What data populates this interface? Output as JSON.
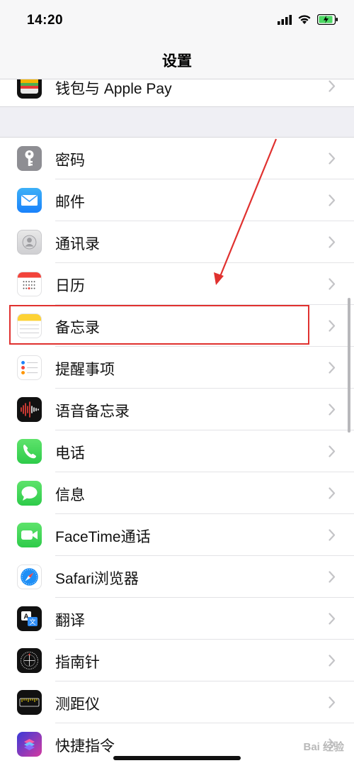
{
  "status_bar": {
    "time": "14:20",
    "icons": [
      "signal-icon",
      "wifi-icon",
      "battery-charging-icon"
    ],
    "battery_color": "#4cd964"
  },
  "nav": {
    "title": "设置"
  },
  "rows": [
    {
      "label": "钱包与 Apple Pay",
      "icon": "wallet-icon"
    },
    {
      "label": "密码",
      "icon": "key-icon"
    },
    {
      "label": "邮件",
      "icon": "mail-icon"
    },
    {
      "label": "通讯录",
      "icon": "contacts-icon"
    },
    {
      "label": "日历",
      "icon": "calendar-icon"
    },
    {
      "label": "备忘录",
      "icon": "notes-icon"
    },
    {
      "label": "提醒事项",
      "icon": "reminders-icon"
    },
    {
      "label": "语音备忘录",
      "icon": "voice-memos-icon"
    },
    {
      "label": "电话",
      "icon": "phone-icon"
    },
    {
      "label": "信息",
      "icon": "messages-icon"
    },
    {
      "label": "FaceTime通话",
      "icon": "facetime-icon"
    },
    {
      "label": "Safari浏览器",
      "icon": "safari-icon"
    },
    {
      "label": "翻译",
      "icon": "translate-icon"
    },
    {
      "label": "指南针",
      "icon": "compass-icon"
    },
    {
      "label": "测距仪",
      "icon": "measure-icon"
    },
    {
      "label": "快捷指令",
      "icon": "shortcuts-icon"
    }
  ],
  "highlight": {
    "target": "备忘录",
    "color": "#e0312f"
  },
  "watermark": "Bai 经验"
}
